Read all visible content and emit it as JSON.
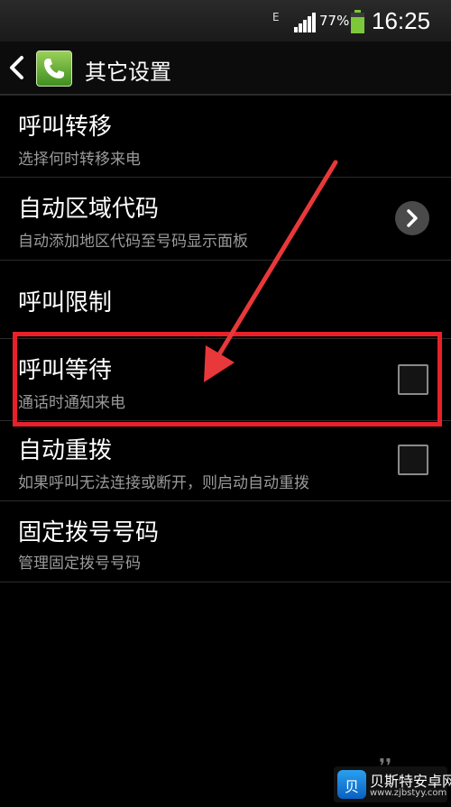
{
  "status_bar": {
    "network_type": "E",
    "battery_percent": "77%",
    "time": "16:25"
  },
  "action_bar": {
    "title": "其它设置",
    "icon": "phone-icon"
  },
  "settings": [
    {
      "title": "呼叫转移",
      "subtitle": "选择何时转移来电"
    },
    {
      "title": "自动区域代码",
      "subtitle": "自动添加地区代码至号码显示面板"
    },
    {
      "title": "呼叫限制",
      "subtitle": ""
    },
    {
      "title": "呼叫等待",
      "subtitle": "通话时通知来电"
    },
    {
      "title": "自动重拨",
      "subtitle": "如果呼叫无法连接或断开，则启动自动重拨"
    },
    {
      "title": "固定拨号号码",
      "subtitle": "管理固定拨号号码"
    }
  ],
  "watermark": {
    "logo_char": "贝",
    "name": "贝斯特安卓网",
    "url": "www.zjbstyy.com"
  },
  "colors": {
    "highlight": "#e8202a",
    "arrow": "#e8383a",
    "subtitle": "#9a9a9a"
  }
}
